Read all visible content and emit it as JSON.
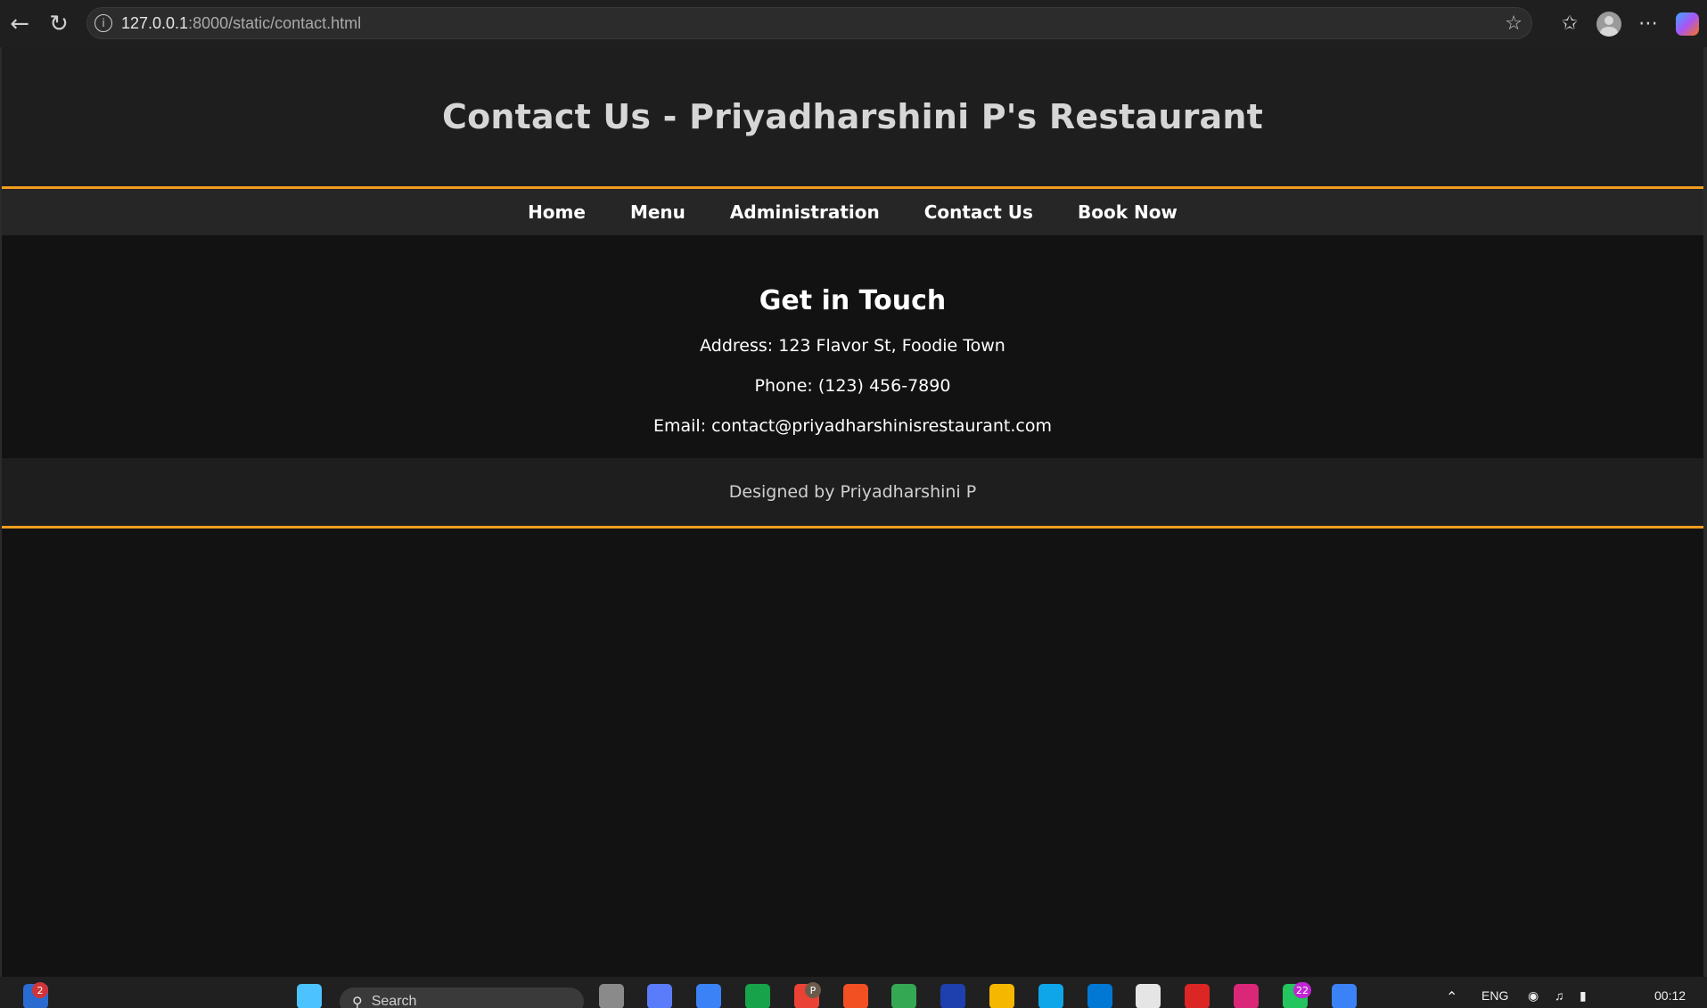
{
  "browser": {
    "url_host": "127.0.0.1",
    "url_path": ":8000/static/contact.html",
    "icons": [
      "back-icon",
      "reload-icon",
      "info-icon",
      "star-icon",
      "favorites-icon",
      "profile-icon",
      "more-icon",
      "copilot-icon"
    ]
  },
  "page": {
    "title": "Contact Us - Priyadharshini P's Restaurant",
    "nav": [
      "Home",
      "Menu",
      "Administration",
      "Contact Us",
      "Book Now"
    ],
    "contact": {
      "heading": "Get in Touch",
      "address": "Address: 123 Flavor St, Foodie Town",
      "phone": "Phone: (123) 456-7890",
      "email": "Email: contact@priyadharshinisrestaurant.com"
    },
    "footer": "Designed by Priyadharshini P",
    "colors": {
      "accent": "#f39c1f",
      "header_bg": "#1e1e1e",
      "nav_bg": "#262626",
      "body_bg": "#121212"
    }
  },
  "taskbar": {
    "widgets_badge": "2",
    "search_placeholder": "Search",
    "chrome_badge": "P",
    "whatsapp_badge": "22",
    "language": "ENG",
    "time": "00:12"
  }
}
